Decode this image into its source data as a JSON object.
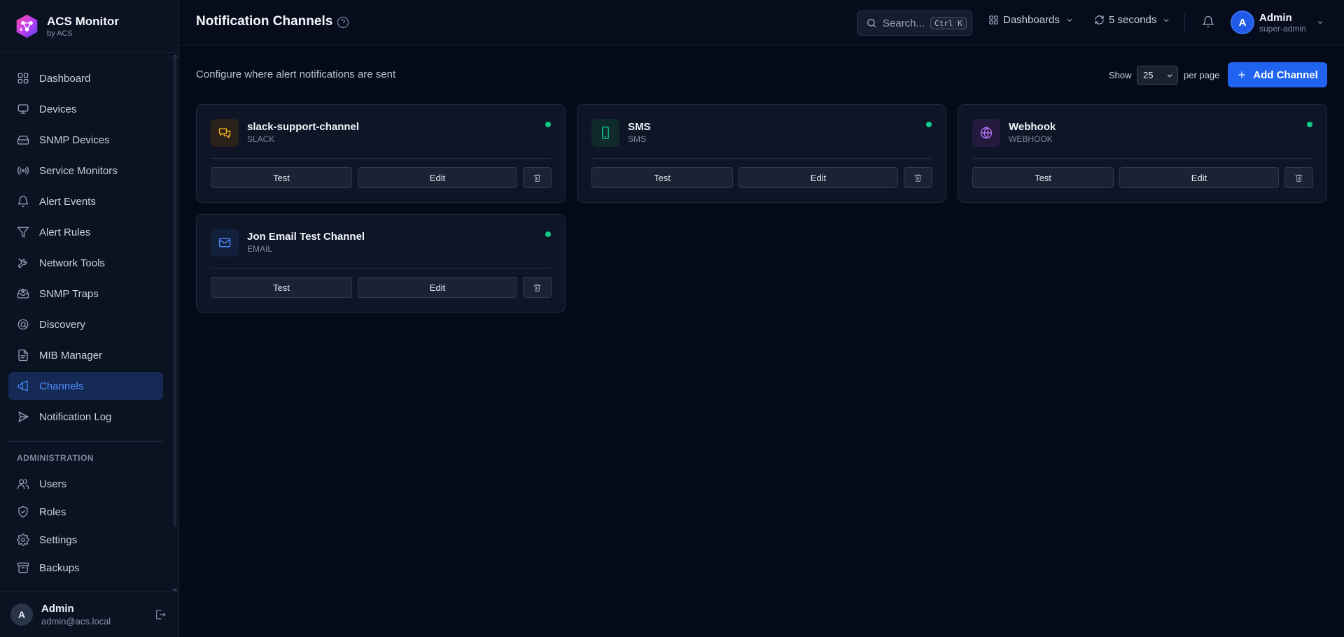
{
  "brand": {
    "title": "ACS Monitor",
    "subtitle": "by ACS"
  },
  "nav": {
    "items": [
      {
        "label": "Dashboard",
        "icon": "grid-icon"
      },
      {
        "label": "Devices",
        "icon": "monitor-icon"
      },
      {
        "label": "SNMP Devices",
        "icon": "hard-drive-icon"
      },
      {
        "label": "Service Monitors",
        "icon": "radio-icon"
      },
      {
        "label": "Alert Events",
        "icon": "bell-icon"
      },
      {
        "label": "Alert Rules",
        "icon": "filter-icon"
      },
      {
        "label": "Network Tools",
        "icon": "tools-icon"
      },
      {
        "label": "SNMP Traps",
        "icon": "inbox-icon"
      },
      {
        "label": "Discovery",
        "icon": "discovery-icon"
      },
      {
        "label": "MIB Manager",
        "icon": "file-icon"
      },
      {
        "label": "Channels",
        "icon": "megaphone-icon",
        "active": true
      },
      {
        "label": "Notification Log",
        "icon": "send-icon"
      }
    ],
    "admin_section": "ADMINISTRATION",
    "admin_items": [
      {
        "label": "Users",
        "icon": "users-icon"
      },
      {
        "label": "Roles",
        "icon": "shield-icon"
      },
      {
        "label": "Settings",
        "icon": "gear-icon"
      },
      {
        "label": "Backups",
        "icon": "archive-icon"
      }
    ]
  },
  "footer_user": {
    "initial": "A",
    "name": "Admin",
    "email": "admin@acs.local"
  },
  "header": {
    "title": "Notification Channels",
    "search_placeholder": "Search...",
    "search_shortcut": "Ctrl K",
    "dashboards_label": "Dashboards",
    "refresh_label": "5 seconds",
    "user": {
      "initial": "A",
      "name": "Admin",
      "role": "super-admin"
    }
  },
  "main": {
    "subtitle": "Configure where alert notifications are sent",
    "show_label": "Show",
    "per_page_value": "25",
    "per_page_label": "per page",
    "add_button": "Add Channel",
    "test_label": "Test",
    "edit_label": "Edit",
    "channels": [
      {
        "name": "slack-support-channel",
        "type": "SLACK",
        "icon": "chat-icon",
        "icon_color": "#f2b01e",
        "icon_bg": "#2a2219",
        "status": "active"
      },
      {
        "name": "SMS",
        "type": "SMS",
        "icon": "phone-icon",
        "icon_color": "#10c98a",
        "icon_bg": "#0f2a2a",
        "status": "active"
      },
      {
        "name": "Webhook",
        "type": "WEBHOOK",
        "icon": "globe-icon",
        "icon_color": "#b070f0",
        "icon_bg": "#231a3e",
        "status": "active"
      },
      {
        "name": "Jon Email Test Channel",
        "type": "EMAIL",
        "icon": "mail-icon",
        "icon_color": "#4d8cff",
        "icon_bg": "#12203c",
        "status": "active"
      }
    ]
  },
  "colors": {
    "accent": "#1f63f0",
    "status_active": "#10c98a",
    "background": "#050a18"
  }
}
